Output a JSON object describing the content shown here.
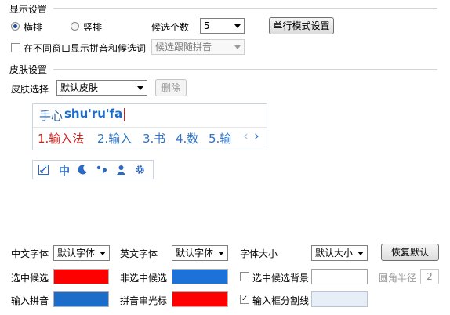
{
  "display": {
    "title": "显示设置",
    "radio_horizontal": "横排",
    "radio_vertical": "竖排",
    "candidate_count_label": "候选个数",
    "candidate_count_value": "5",
    "single_line_button": "单行模式设置",
    "separate_window_label": "在不同窗口显示拼音和候选词",
    "separate_window_checked": false,
    "follow_select_value": "候选跟随拼音"
  },
  "skin": {
    "title": "皮肤设置",
    "select_label": "皮肤选择",
    "select_value": "默认皮肤",
    "delete_button": "删除"
  },
  "preview": {
    "brand": "手心",
    "pinyin": "shu'ru'fa",
    "candidates": [
      "1.输入法",
      "2.输入",
      "3.书",
      "4.数",
      "5.输"
    ],
    "nav_prev": "‹",
    "nav_next": "›",
    "toolbar_zh": "中",
    "toolbar_icons": [
      "edit-icon",
      "chinese-mode-icon",
      "moon-icon",
      "punctuation-icon",
      "user-icon",
      "gear-icon"
    ]
  },
  "fonts": {
    "chinese_label": "中文字体",
    "chinese_value": "默认字体",
    "english_label": "英文字体",
    "english_value": "默认字体",
    "size_label": "字体大小",
    "size_value": "默认大小",
    "restore_button": "恢复默认"
  },
  "colors": {
    "selected_candidate_label": "选中候选",
    "selected_candidate_color": "#ff0000",
    "unselected_candidate_label": "非选中候选",
    "unselected_candidate_color": "#1c72d8",
    "selected_bg_label": "选中候选背景",
    "selected_bg_checked": false,
    "corner_radius_label": "圆角半径",
    "corner_radius_value": "2",
    "input_pinyin_label": "输入拼音",
    "input_pinyin_color": "#1c6cc9",
    "cursor_label": "拼音串光标",
    "cursor_color": "#ff0000",
    "divider_label": "输入框分割线",
    "divider_checked": true,
    "divider_check_glyph": "✓",
    "accent_red": "#d0201b",
    "accent_blue": "#2b73c4"
  }
}
